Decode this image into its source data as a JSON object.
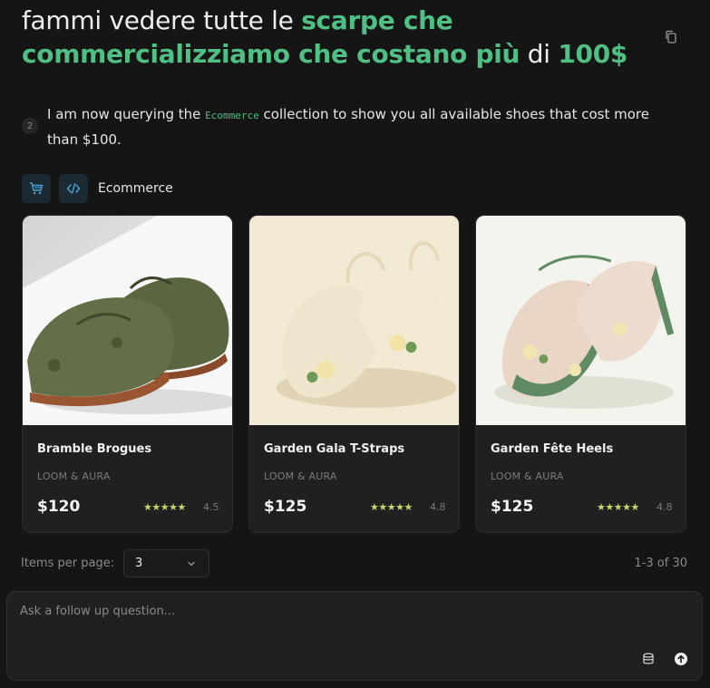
{
  "query": {
    "part1": "fammi vedere tutte le ",
    "highlight1": "scarpe che commercializziamo che costano più",
    "part2": " di ",
    "highlight2": "100$"
  },
  "icons": {
    "copy": "copy-icon",
    "cart": "shopping-cart-icon",
    "code": "code-icon",
    "chevron": "chevron-down-icon",
    "database": "database-icon",
    "send": "arrow-up-icon"
  },
  "colors": {
    "accent": "#4fbf84",
    "stars": "#c7d86a",
    "background": "#151515",
    "card": "#202020"
  },
  "message": {
    "step": "2",
    "before": "I am now querying the ",
    "code": "Ecommerce",
    "after": " collection to show you all available shoes that cost more than $100."
  },
  "tool": {
    "label": "Ecommerce"
  },
  "products": [
    {
      "name": "Bramble Brogues",
      "brand": "LOOM & AURA",
      "price": "$120",
      "stars": "★★★★★",
      "rating": "4.5",
      "image": "green-suede-brogue-shoes"
    },
    {
      "name": "Garden Gala T-Straps",
      "brand": "LOOM & AURA",
      "price": "$125",
      "stars": "★★★★★",
      "rating": "4.8",
      "image": "cream-floral-t-strap-heels"
    },
    {
      "name": "Garden Fête Heels",
      "brand": "LOOM & AURA",
      "price": "$125",
      "stars": "★★★★★",
      "rating": "4.8",
      "image": "lace-floral-green-heels"
    }
  ],
  "pagination": {
    "label": "Items per page:",
    "value": "3",
    "range": "1-3 of 30"
  },
  "composer": {
    "placeholder": "Ask a follow up question..."
  }
}
